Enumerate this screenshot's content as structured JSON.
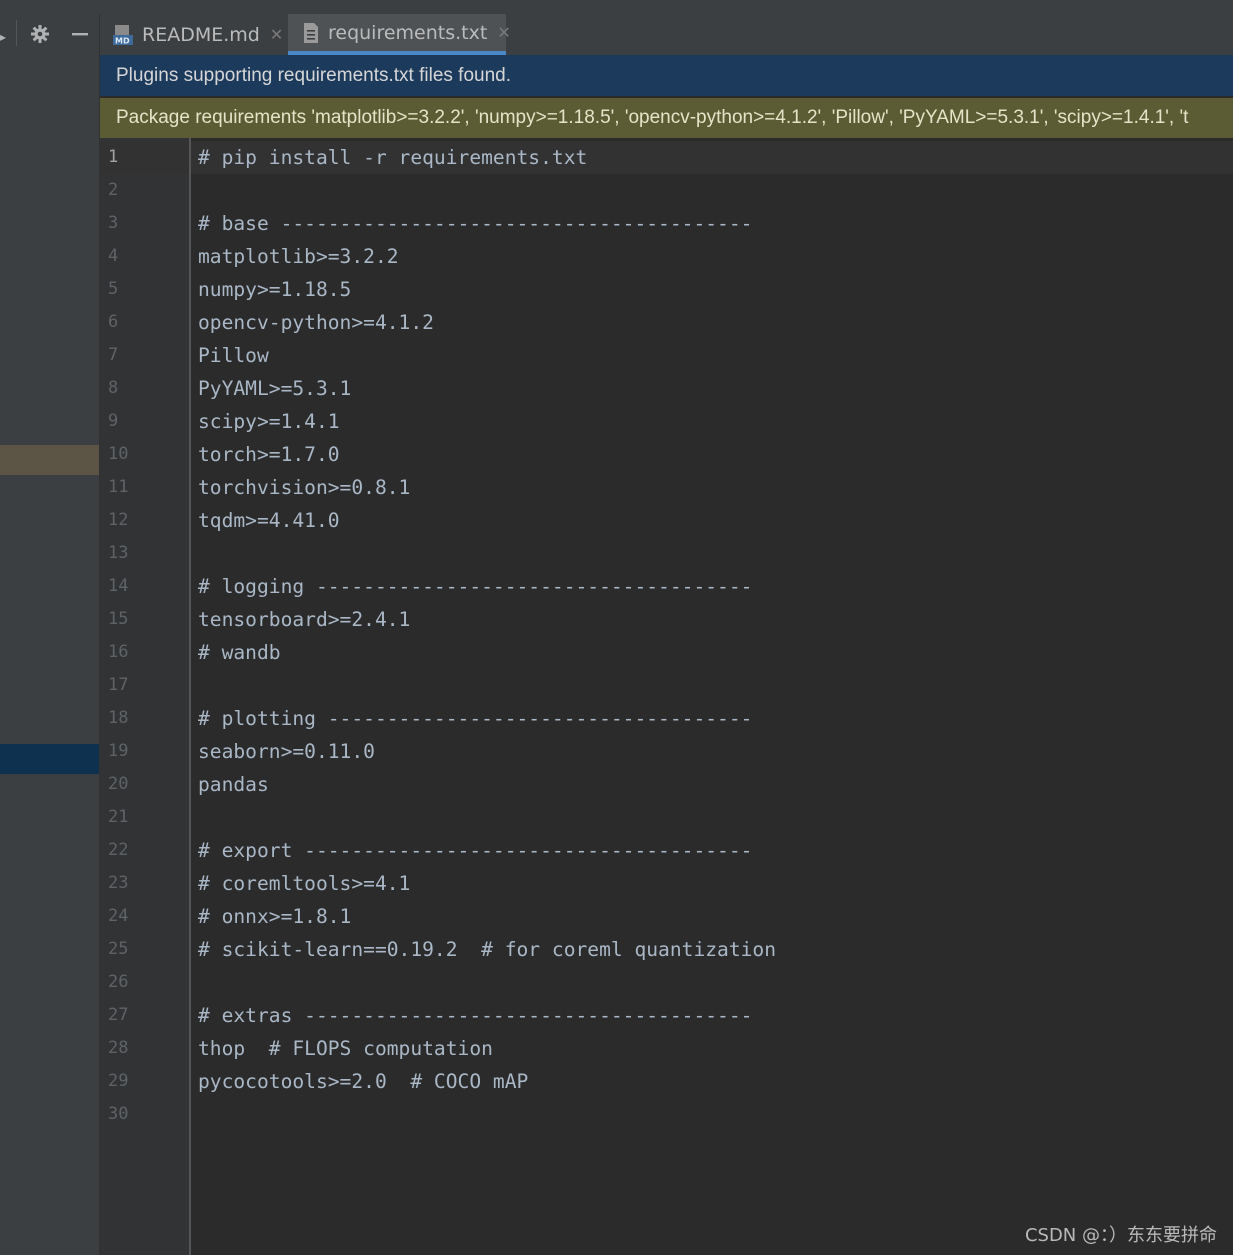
{
  "tabs": [
    {
      "label": "README.md",
      "icon": "markdown-file-icon",
      "active": false
    },
    {
      "label": "requirements.txt",
      "icon": "text-file-icon",
      "active": true
    }
  ],
  "banners": {
    "plugins": "Plugins supporting requirements.txt files found.",
    "packages": "Package requirements 'matplotlib>=3.2.2', 'numpy>=1.18.5', 'opencv-python>=4.1.2', 'Pillow', 'PyYAML>=5.3.1', 'scipy>=1.4.1', 't"
  },
  "editor": {
    "current_line": 1,
    "lines": [
      {
        "n": "1",
        "text": "# pip install -r requirements.txt"
      },
      {
        "n": "2",
        "text": ""
      },
      {
        "n": "3",
        "text": "# base ----------------------------------------"
      },
      {
        "n": "4",
        "text": "matplotlib>=3.2.2"
      },
      {
        "n": "5",
        "text": "numpy>=1.18.5"
      },
      {
        "n": "6",
        "text": "opencv-python>=4.1.2"
      },
      {
        "n": "7",
        "text": "Pillow"
      },
      {
        "n": "8",
        "text": "PyYAML>=5.3.1"
      },
      {
        "n": "9",
        "text": "scipy>=1.4.1"
      },
      {
        "n": "10",
        "text": "torch>=1.7.0"
      },
      {
        "n": "11",
        "text": "torchvision>=0.8.1"
      },
      {
        "n": "12",
        "text": "tqdm>=4.41.0"
      },
      {
        "n": "13",
        "text": ""
      },
      {
        "n": "14",
        "text": "# logging -------------------------------------"
      },
      {
        "n": "15",
        "text": "tensorboard>=2.4.1"
      },
      {
        "n": "16",
        "text": "# wandb"
      },
      {
        "n": "17",
        "text": ""
      },
      {
        "n": "18",
        "text": "# plotting ------------------------------------"
      },
      {
        "n": "19",
        "text": "seaborn>=0.11.0"
      },
      {
        "n": "20",
        "text": "pandas"
      },
      {
        "n": "21",
        "text": ""
      },
      {
        "n": "22",
        "text": "# export --------------------------------------"
      },
      {
        "n": "23",
        "text": "# coremltools>=4.1"
      },
      {
        "n": "24",
        "text": "# onnx>=1.8.1"
      },
      {
        "n": "25",
        "text": "# scikit-learn==0.19.2  # for coreml quantization"
      },
      {
        "n": "26",
        "text": ""
      },
      {
        "n": "27",
        "text": "# extras --------------------------------------"
      },
      {
        "n": "28",
        "text": "thop  # FLOPS computation"
      },
      {
        "n": "29",
        "text": "pycocotools>=2.0  # COCO mAP"
      },
      {
        "n": "30",
        "text": ""
      }
    ]
  },
  "left_toolbar": {
    "settings_icon": "gear-icon",
    "hide_icon": "minimize-icon"
  },
  "watermark": "CSDN @：）​东东要拼命",
  "colors": {
    "accent": "#4a88c7",
    "plugins_banner": "#1c3a5c",
    "packages_banner": "#5c5c34"
  }
}
